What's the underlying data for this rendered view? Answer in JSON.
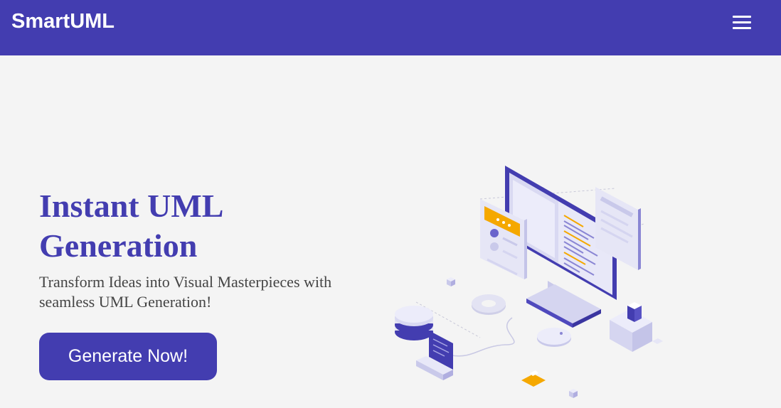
{
  "navbar": {
    "brand": "SmartUML",
    "menu_icon": "hamburger-menu-icon"
  },
  "hero": {
    "title": "Instant UML Generation",
    "subtitle": "Transform Ideas into Visual Masterpieces with seamless UML Generation!",
    "cta_label": "Generate Now!"
  },
  "illustration": {
    "icon": "isometric-computer-illustration",
    "colors": {
      "primary": "#433db0",
      "light": "#d9d9f2",
      "accent": "#f5a800"
    }
  },
  "colors": {
    "navbar_bg": "#433db0",
    "page_bg": "#f4f4f4",
    "title": "#433db0",
    "subtitle": "#444444",
    "button_bg": "#433db0"
  }
}
